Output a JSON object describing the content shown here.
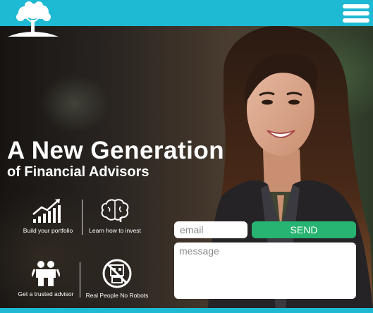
{
  "header": {
    "logo_icon": "tree-logo-icon",
    "menu_icon": "hamburger-menu-icon",
    "background_color": "#1eb9d2"
  },
  "hero": {
    "headline": "A New Generation",
    "subheadline": "of Financial Advisors"
  },
  "features": [
    {
      "icon": "growth-chart-icon",
      "label": "Build your portfolio"
    },
    {
      "icon": "brain-icon",
      "label": "Learn how to invest"
    },
    {
      "icon": "two-people-icon",
      "label": "Get a trusted advisor"
    },
    {
      "icon": "no-robots-icon",
      "label": "Real People No Robots"
    }
  ],
  "contact_form": {
    "email_placeholder": "email",
    "send_label": "SEND",
    "message_placeholder": "message",
    "send_color": "#27b371"
  }
}
